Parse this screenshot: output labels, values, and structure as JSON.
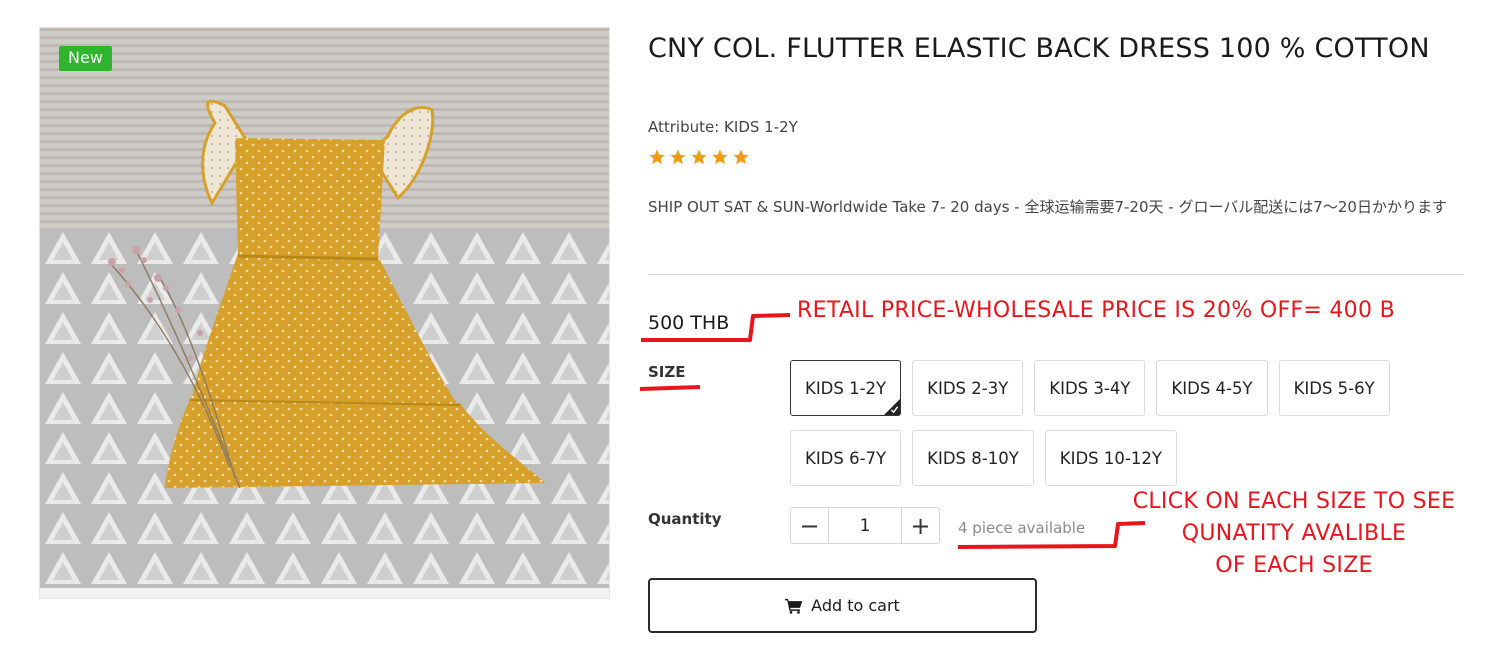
{
  "product": {
    "badge": "New",
    "title": "CNY COL. FLUTTER ELASTIC BACK DRESS 100 % COTTON",
    "attribute": "Attribute: KIDS 1-2Y",
    "rating": 5,
    "shipping": "SHIP OUT SAT & SUN-Worldwide Take 7- 20 days - 全球运输需要7-20天 - グローバル配送には7〜20日かかります",
    "price": "500 THB"
  },
  "size": {
    "label": "SIZE",
    "selected": "KIDS 1-2Y",
    "options": [
      "KIDS 1-2Y",
      "KIDS 2-3Y",
      "KIDS 3-4Y",
      "KIDS 4-5Y",
      "KIDS 5-6Y",
      "KIDS 6-7Y",
      "KIDS 8-10Y",
      "KIDS 10-12Y"
    ]
  },
  "quantity": {
    "label": "Quantity",
    "value": "1",
    "minus": "−",
    "plus": "+",
    "stock": "4 piece available"
  },
  "cart": {
    "label": "Add to cart",
    "icon": "cart-icon"
  },
  "annotations": {
    "price_note": "RETAIL PRICE-WHOLESALE PRICE IS 20% OFF= 400 B",
    "size_note_line1": "CLICK ON EACH SIZE TO SEE",
    "size_note_line2": "QUNATITY AVALIBLE",
    "size_note_line3": "OF EACH SIZE"
  },
  "colors": {
    "badge_green": "#2db52d",
    "star_orange": "#f39c12",
    "annotation_red": "#e8161b",
    "dress_mustard": "#d9a227"
  }
}
